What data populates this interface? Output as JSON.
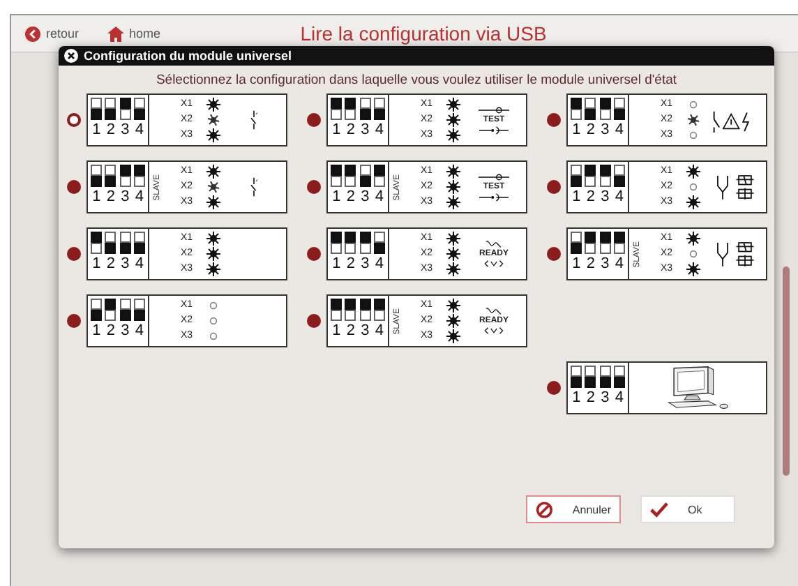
{
  "header": {
    "back": "retour",
    "home": "home",
    "title": "Lire la configuration via USB"
  },
  "dialog": {
    "title": "Configuration du module universel",
    "prompt": "Sélectionnez la configuration dans laquelle vous voulez utiliser le module universel d'état",
    "options": [
      {
        "selected": true,
        "switches": [
          {
            "label": "1",
            "on": false
          },
          {
            "label": "2",
            "on": false
          },
          {
            "label": "3",
            "on": true
          },
          {
            "label": "4",
            "on": false
          }
        ],
        "leds": [
          {
            "label": "X1",
            "lit": true,
            "flashing": false
          },
          {
            "label": "X2",
            "lit": true,
            "flashing": true
          },
          {
            "label": "X3",
            "lit": true,
            "flashing": false
          }
        ],
        "symbol": {
          "kind": "contact"
        }
      },
      {
        "selected": false,
        "switches": [
          {
            "label": "1",
            "on": true
          },
          {
            "label": "2",
            "on": true
          },
          {
            "label": "3",
            "on": false
          },
          {
            "label": "4",
            "on": false
          }
        ],
        "leds": [
          {
            "label": "X1",
            "lit": true,
            "flashing": false
          },
          {
            "label": "X2",
            "lit": true,
            "flashing": false
          },
          {
            "label": "X3",
            "lit": true,
            "flashing": false
          }
        ],
        "symbol": {
          "kind": "test",
          "label": "TEST"
        }
      },
      {
        "selected": false,
        "switches": [
          {
            "label": "1",
            "on": true
          },
          {
            "label": "2",
            "on": false
          },
          {
            "label": "3",
            "on": true
          },
          {
            "label": "4",
            "on": false
          }
        ],
        "leds": [
          {
            "label": "X1",
            "lit": false,
            "flashing": false
          },
          {
            "label": "X2",
            "lit": true,
            "flashing": true
          },
          {
            "label": "X3",
            "lit": false,
            "flashing": false
          }
        ],
        "symbol": {
          "kind": "warning"
        }
      },
      {
        "selected": false,
        "switches": [
          {
            "label": "1",
            "on": false
          },
          {
            "label": "2",
            "on": false
          },
          {
            "label": "3",
            "on": true
          },
          {
            "label": "4",
            "on": true
          }
        ],
        "slave_label": "SLAVE",
        "leds": [
          {
            "label": "X1",
            "lit": true,
            "flashing": false
          },
          {
            "label": "X2",
            "lit": true,
            "flashing": true
          },
          {
            "label": "X3",
            "lit": true,
            "flashing": false
          }
        ],
        "symbol": {
          "kind": "contact"
        }
      },
      {
        "selected": false,
        "switches": [
          {
            "label": "1",
            "on": true
          },
          {
            "label": "2",
            "on": true
          },
          {
            "label": "3",
            "on": false
          },
          {
            "label": "4",
            "on": true
          }
        ],
        "slave_label": "SLAVE",
        "leds": [
          {
            "label": "X1",
            "lit": true,
            "flashing": false
          },
          {
            "label": "X2",
            "lit": true,
            "flashing": false
          },
          {
            "label": "X3",
            "lit": true,
            "flashing": false
          }
        ],
        "symbol": {
          "kind": "test",
          "label": "TEST"
        }
      },
      {
        "selected": false,
        "switches": [
          {
            "label": "1",
            "on": false
          },
          {
            "label": "2",
            "on": true
          },
          {
            "label": "3",
            "on": true
          },
          {
            "label": "4",
            "on": false
          }
        ],
        "leds": [
          {
            "label": "X1",
            "lit": true,
            "flashing": false
          },
          {
            "label": "X2",
            "lit": false,
            "flashing": false
          },
          {
            "label": "X3",
            "lit": true,
            "flashing": false
          }
        ],
        "symbol": {
          "kind": "relay"
        }
      },
      {
        "selected": false,
        "switches": [
          {
            "label": "1",
            "on": true
          },
          {
            "label": "2",
            "on": false
          },
          {
            "label": "3",
            "on": false
          },
          {
            "label": "4",
            "on": false
          }
        ],
        "leds": [
          {
            "label": "X1",
            "lit": true,
            "flashing": false
          },
          {
            "label": "X2",
            "lit": true,
            "flashing": false
          },
          {
            "label": "X3",
            "lit": true,
            "flashing": false
          }
        ],
        "symbol": {
          "kind": "none"
        }
      },
      {
        "selected": false,
        "switches": [
          {
            "label": "1",
            "on": true
          },
          {
            "label": "2",
            "on": true
          },
          {
            "label": "3",
            "on": true
          },
          {
            "label": "4",
            "on": false
          }
        ],
        "leds": [
          {
            "label": "X1",
            "lit": true,
            "flashing": false
          },
          {
            "label": "X2",
            "lit": true,
            "flashing": false
          },
          {
            "label": "X3",
            "lit": true,
            "flashing": false
          }
        ],
        "symbol": {
          "kind": "ready",
          "label": "READY"
        }
      },
      {
        "selected": false,
        "switches": [
          {
            "label": "1",
            "on": false
          },
          {
            "label": "2",
            "on": true
          },
          {
            "label": "3",
            "on": true
          },
          {
            "label": "4",
            "on": true
          }
        ],
        "slave_label": "SLAVE",
        "leds": [
          {
            "label": "X1",
            "lit": true,
            "flashing": false
          },
          {
            "label": "X2",
            "lit": false,
            "flashing": false
          },
          {
            "label": "X3",
            "lit": true,
            "flashing": false
          }
        ],
        "symbol": {
          "kind": "relay"
        }
      },
      {
        "selected": false,
        "switches": [
          {
            "label": "1",
            "on": false
          },
          {
            "label": "2",
            "on": true
          },
          {
            "label": "3",
            "on": false
          },
          {
            "label": "4",
            "on": false
          }
        ],
        "leds": [
          {
            "label": "X1",
            "lit": false,
            "flashing": false
          },
          {
            "label": "X2",
            "lit": false,
            "flashing": false
          },
          {
            "label": "X3",
            "lit": false,
            "flashing": false
          }
        ],
        "symbol": {
          "kind": "none"
        }
      },
      {
        "selected": false,
        "switches": [
          {
            "label": "1",
            "on": true
          },
          {
            "label": "2",
            "on": true
          },
          {
            "label": "3",
            "on": true
          },
          {
            "label": "4",
            "on": true
          }
        ],
        "slave_label": "SLAVE",
        "leds": [
          {
            "label": "X1",
            "lit": true,
            "flashing": false
          },
          {
            "label": "X2",
            "lit": true,
            "flashing": false
          },
          {
            "label": "X3",
            "lit": true,
            "flashing": false
          }
        ],
        "symbol": {
          "kind": "ready",
          "label": "READY"
        }
      },
      {
        "selected": false,
        "switches": [
          {
            "label": "1",
            "on": false
          },
          {
            "label": "2",
            "on": false
          },
          {
            "label": "3",
            "on": false
          },
          {
            "label": "4",
            "on": false
          }
        ],
        "symbol": {
          "kind": "computer"
        }
      }
    ],
    "buttons": [
      {
        "kind": "cancel",
        "label": "Annuler"
      },
      {
        "kind": "ok",
        "label": "Ok"
      }
    ]
  }
}
